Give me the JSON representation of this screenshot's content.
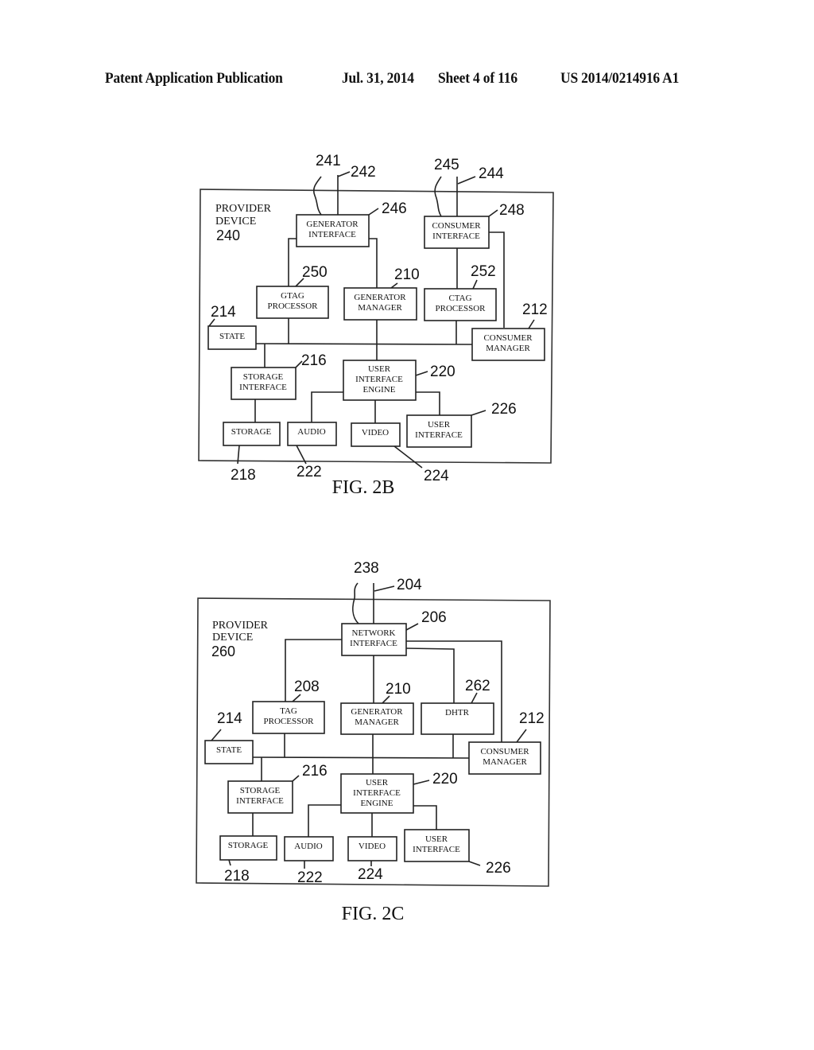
{
  "header": {
    "publication": "Patent Application Publication",
    "date": "Jul. 31, 2014",
    "sheet": "Sheet 4 of 116",
    "number": "US 2014/0214916 A1"
  },
  "fig2b": {
    "caption": "FIG. 2B",
    "device": {
      "line1": "PROVIDER",
      "line2": "DEVICE",
      "ref": "240"
    },
    "refs": {
      "r241": "241",
      "r242": "242",
      "r245": "245",
      "r244": "244",
      "r246": "246",
      "r248": "248",
      "r250": "250",
      "r210": "210",
      "r252": "252",
      "r214": "214",
      "r212": "212",
      "r216": "216",
      "r220": "220",
      "r226": "226",
      "r218": "218",
      "r222": "222",
      "r224": "224"
    },
    "boxes": {
      "generator_interface": [
        "GENERATOR",
        "INTERFACE"
      ],
      "consumer_interface": [
        "CONSUMER",
        "INTERFACE"
      ],
      "gtag_processor": [
        "GTAG",
        "PROCESSOR"
      ],
      "generator_manager": [
        "GENERATOR",
        "MANAGER"
      ],
      "ctag_processor": [
        "CTAG",
        "PROCESSOR"
      ],
      "state": [
        "STATE"
      ],
      "consumer_manager": [
        "CONSUMER",
        "MANAGER"
      ],
      "storage_interface": [
        "STORAGE",
        "INTERFACE"
      ],
      "ui_engine": [
        "USER",
        "INTERFACE",
        "ENGINE"
      ],
      "storage": [
        "STORAGE"
      ],
      "audio": [
        "AUDIO"
      ],
      "video": [
        "VIDEO"
      ],
      "user_interface": [
        "USER",
        "INTERFACE"
      ]
    }
  },
  "fig2c": {
    "caption": "FIG. 2C",
    "device": {
      "line1": "PROVIDER",
      "line2": "DEVICE",
      "ref": "260"
    },
    "refs": {
      "r238": "238",
      "r204": "204",
      "r206": "206",
      "r208": "208",
      "r210": "210",
      "r262": "262",
      "r214": "214",
      "r212": "212",
      "r216": "216",
      "r220": "220",
      "r226": "226",
      "r218": "218",
      "r222": "222",
      "r224": "224"
    },
    "boxes": {
      "network_interface": [
        "NETWORK",
        "INTERFACE"
      ],
      "tag_processor": [
        "TAG",
        "PROCESSOR"
      ],
      "generator_manager": [
        "GENERATOR",
        "MANAGER"
      ],
      "dhtr": [
        "DHTR"
      ],
      "state": [
        "STATE"
      ],
      "consumer_manager": [
        "CONSUMER",
        "MANAGER"
      ],
      "storage_interface": [
        "STORAGE",
        "INTERFACE"
      ],
      "ui_engine": [
        "USER",
        "INTERFACE",
        "ENGINE"
      ],
      "storage": [
        "STORAGE"
      ],
      "audio": [
        "AUDIO"
      ],
      "video": [
        "VIDEO"
      ],
      "user_interface": [
        "USER",
        "INTERFACE"
      ]
    }
  }
}
